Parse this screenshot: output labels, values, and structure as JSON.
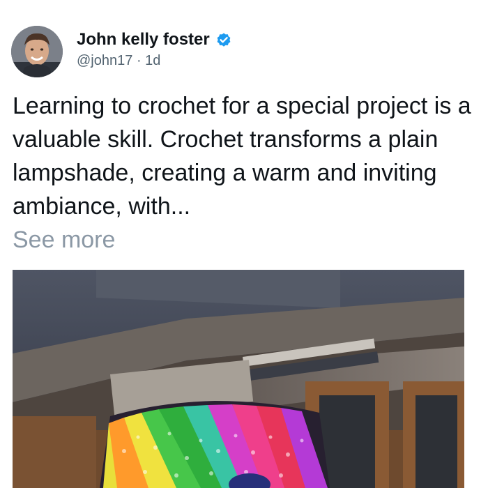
{
  "post": {
    "author": {
      "display_name": "John kelly foster",
      "handle": "@john17",
      "separator": "·",
      "age": "1d",
      "verified_icon": "verified-badge-icon",
      "avatar": "profile-photo"
    },
    "body_text": "Learning to crochet for a special project is a valuable skill. Crochet transforms a plain lampshade, creating a warm and inviting ambiance, with...",
    "see_more_label": "See more",
    "media": {
      "kind": "photo",
      "subject": "rainbow-crochet-lampshade"
    }
  },
  "colors": {
    "verified_blue": "#1d9bf0",
    "text_primary": "#0f1419",
    "text_secondary": "#536471",
    "see_more": "#8b98a5"
  }
}
